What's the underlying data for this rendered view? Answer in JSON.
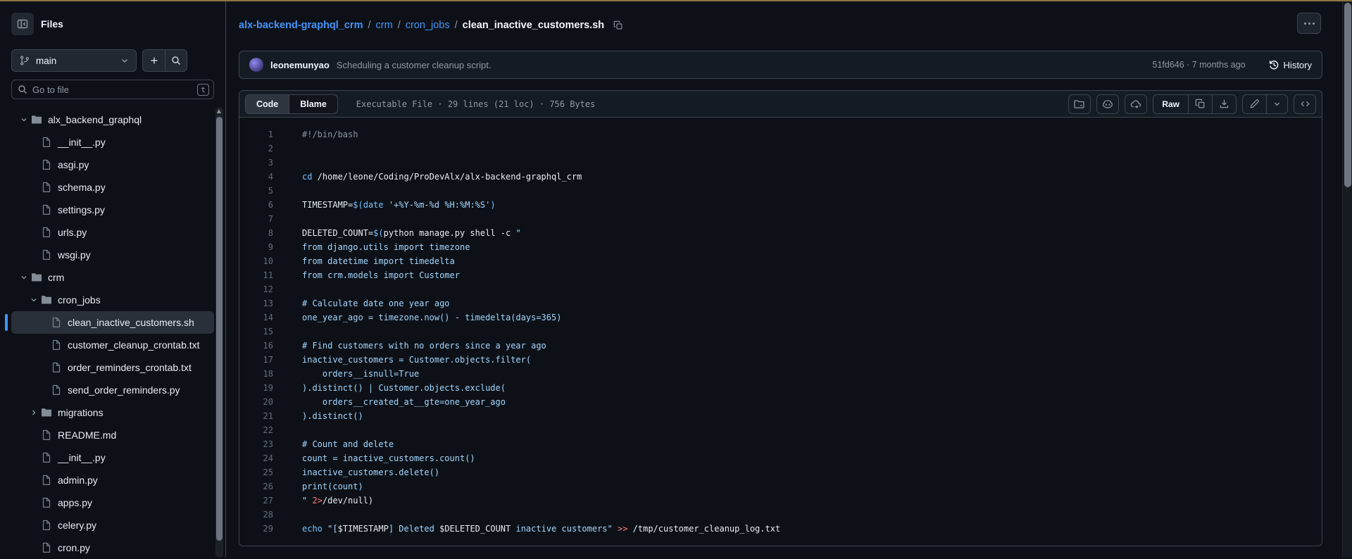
{
  "theme": {
    "bg": "#0d1117",
    "panel": "#151b23",
    "border": "#3d444d",
    "muted": "#9198a1",
    "fg": "#f0f6fc",
    "link": "#4493f8",
    "accent_top": "#8a753b",
    "selected_bar": "#4493f8",
    "code_plain": "#e6edf3",
    "code_keyword": "#79c0ff",
    "code_string": "#a5d6ff",
    "code_comment": "#8b949e",
    "code_red": "#ff7b72",
    "line_number": "#636e7b"
  },
  "sidebar": {
    "title": "Files",
    "branch": {
      "name": "main"
    },
    "goto": {
      "placeholder": "Go to file",
      "shortcut": "t"
    },
    "tree": [
      {
        "label": "alx_backend_graphql",
        "type": "folder",
        "depth": 0,
        "expanded": true
      },
      {
        "label": "__init__.py",
        "type": "file",
        "depth": 1
      },
      {
        "label": "asgi.py",
        "type": "file",
        "depth": 1
      },
      {
        "label": "schema.py",
        "type": "file",
        "depth": 1
      },
      {
        "label": "settings.py",
        "type": "file",
        "depth": 1
      },
      {
        "label": "urls.py",
        "type": "file",
        "depth": 1
      },
      {
        "label": "wsgi.py",
        "type": "file",
        "depth": 1
      },
      {
        "label": "crm",
        "type": "folder",
        "depth": 0,
        "expanded": true
      },
      {
        "label": "cron_jobs",
        "type": "folder",
        "depth": 1,
        "expanded": true
      },
      {
        "label": "clean_inactive_customers.sh",
        "type": "file",
        "depth": 2,
        "selected": true
      },
      {
        "label": "customer_cleanup_crontab.txt",
        "type": "file",
        "depth": 2
      },
      {
        "label": "order_reminders_crontab.txt",
        "type": "file",
        "depth": 2
      },
      {
        "label": "send_order_reminders.py",
        "type": "file",
        "depth": 2
      },
      {
        "label": "migrations",
        "type": "folder",
        "depth": 1,
        "expanded": false
      },
      {
        "label": "README.md",
        "type": "file",
        "depth": 1
      },
      {
        "label": "__init__.py",
        "type": "file",
        "depth": 1
      },
      {
        "label": "admin.py",
        "type": "file",
        "depth": 1
      },
      {
        "label": "apps.py",
        "type": "file",
        "depth": 1
      },
      {
        "label": "celery.py",
        "type": "file",
        "depth": 1
      },
      {
        "label": "cron.py",
        "type": "file",
        "depth": 1
      }
    ]
  },
  "breadcrumb": {
    "links": [
      "alx-backend-graphql_crm",
      "crm",
      "cron_jobs"
    ],
    "current": "clean_inactive_customers.sh",
    "separator": "/"
  },
  "commit": {
    "author": "leonemunyao",
    "message": "Scheduling a customer cleanup script.",
    "meta": "51fd646 · 7 months ago",
    "history_label": "History"
  },
  "file_panel": {
    "tab_code": "Code",
    "tab_blame": "Blame",
    "meta": "Executable File · 29 lines (21 loc) · 756 Bytes",
    "raw_label": "Raw"
  },
  "code": {
    "lines": [
      {
        "n": 1,
        "tokens": [
          [
            "#!/bin/bash",
            "cm"
          ]
        ]
      },
      {
        "n": 2,
        "tokens": []
      },
      {
        "n": 3,
        "tokens": []
      },
      {
        "n": 4,
        "tokens": [
          [
            "cd",
            "kw"
          ],
          [
            " /home/leone/Coding/ProDevAlx/alx-backend-graphql_crm",
            "pl"
          ]
        ]
      },
      {
        "n": 5,
        "tokens": []
      },
      {
        "n": 6,
        "tokens": [
          [
            "TIMESTAMP=",
            "pl"
          ],
          [
            "$(",
            "kw"
          ],
          [
            "date",
            "kw"
          ],
          [
            " ",
            "pl"
          ],
          [
            "'+%Y-%m-%d %H:%M:%S'",
            "str"
          ],
          [
            ")",
            "kw"
          ]
        ]
      },
      {
        "n": 7,
        "tokens": []
      },
      {
        "n": 8,
        "tokens": [
          [
            "DELETED_COUNT=",
            "pl"
          ],
          [
            "$(",
            "kw"
          ],
          [
            "python manage.py shell -c ",
            "pl"
          ],
          [
            "\"",
            "str"
          ]
        ]
      },
      {
        "n": 9,
        "tokens": [
          [
            "from django.utils import timezone",
            "str"
          ]
        ]
      },
      {
        "n": 10,
        "tokens": [
          [
            "from datetime import timedelta",
            "str"
          ]
        ]
      },
      {
        "n": 11,
        "tokens": [
          [
            "from crm.models import Customer",
            "str"
          ]
        ]
      },
      {
        "n": 12,
        "tokens": []
      },
      {
        "n": 13,
        "tokens": [
          [
            "# Calculate date one year ago",
            "str"
          ]
        ]
      },
      {
        "n": 14,
        "tokens": [
          [
            "one_year_ago = timezone.now() - timedelta(days=365)",
            "str"
          ]
        ]
      },
      {
        "n": 15,
        "tokens": []
      },
      {
        "n": 16,
        "tokens": [
          [
            "# Find customers with no orders since a year ago",
            "str"
          ]
        ]
      },
      {
        "n": 17,
        "tokens": [
          [
            "inactive_customers = Customer.objects.filter(",
            "str"
          ]
        ]
      },
      {
        "n": 18,
        "tokens": [
          [
            "    orders__isnull=True",
            "str"
          ]
        ]
      },
      {
        "n": 19,
        "tokens": [
          [
            ").distinct() | Customer.objects.exclude(",
            "str"
          ]
        ]
      },
      {
        "n": 20,
        "tokens": [
          [
            "    orders__created_at__gte=one_year_ago",
            "str"
          ]
        ]
      },
      {
        "n": 21,
        "tokens": [
          [
            ").distinct()",
            "str"
          ]
        ]
      },
      {
        "n": 22,
        "tokens": []
      },
      {
        "n": 23,
        "tokens": [
          [
            "# Count and delete",
            "str"
          ]
        ]
      },
      {
        "n": 24,
        "tokens": [
          [
            "count = inactive_customers.count()",
            "str"
          ]
        ]
      },
      {
        "n": 25,
        "tokens": [
          [
            "inactive_customers.delete()",
            "str"
          ]
        ]
      },
      {
        "n": 26,
        "tokens": [
          [
            "print(count)",
            "str"
          ]
        ]
      },
      {
        "n": 27,
        "tokens": [
          [
            "\" ",
            "str"
          ],
          [
            "2>",
            "red"
          ],
          [
            "/dev/null)",
            "pl"
          ]
        ]
      },
      {
        "n": 28,
        "tokens": []
      },
      {
        "n": 29,
        "tokens": [
          [
            "echo",
            "kw"
          ],
          [
            " ",
            "pl"
          ],
          [
            "\"[",
            "str"
          ],
          [
            "$TIMESTAMP",
            "pl"
          ],
          [
            "] Deleted ",
            "str"
          ],
          [
            "$DELETED_COUNT",
            "pl"
          ],
          [
            " inactive customers\"",
            "str"
          ],
          [
            " ",
            "pl"
          ],
          [
            ">>",
            "red"
          ],
          [
            " /tmp/customer_cleanup_log.txt",
            "pl"
          ]
        ]
      }
    ]
  }
}
